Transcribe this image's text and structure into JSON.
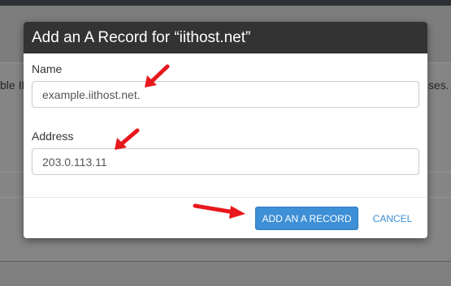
{
  "background": {
    "left_fragment": "ble IP",
    "right_fragment": "ses. T"
  },
  "modal": {
    "title": "Add an A Record for “iithost.net”",
    "name_field": {
      "label": "Name",
      "value": "example.iithost.net."
    },
    "address_field": {
      "label": "Address",
      "value": "203.0.113.11"
    },
    "buttons": {
      "add_label": "ADD AN A RECORD",
      "cancel_label": "CANCEL"
    }
  },
  "annotations": {
    "arrow_icon": "red-arrow-icon",
    "arrow_color": "#e8171c"
  },
  "colors": {
    "header_bg": "#333333",
    "primary": "#3d8fd6",
    "overlay": "#7d7d7d"
  }
}
